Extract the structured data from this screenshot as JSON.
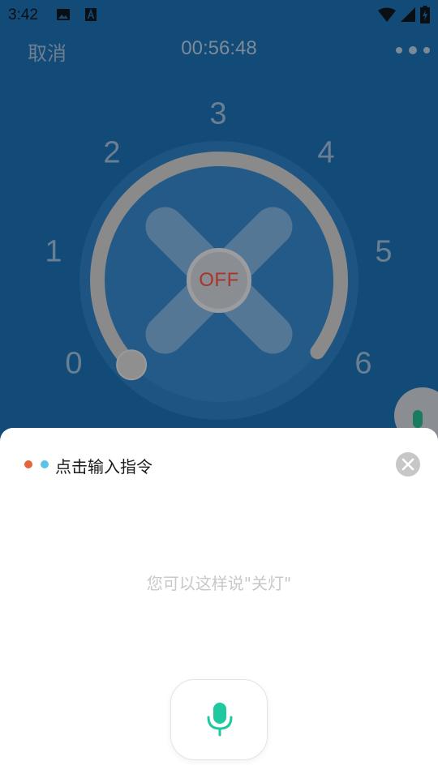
{
  "statusbar": {
    "time": "3:42",
    "icons": [
      "image-icon",
      "a-notification-icon",
      "wifi-icon",
      "cell-signal-icon",
      "battery-charging-icon"
    ]
  },
  "topbar": {
    "cancel_label": "取消",
    "timer": "00:56:48",
    "more_icon": "more-dots-icon"
  },
  "fan": {
    "speed_labels": [
      "0",
      "1",
      "2",
      "3",
      "4",
      "5",
      "6"
    ],
    "current_speed": 0,
    "power_label": "OFF",
    "colors": {
      "power_text": "#a8342c",
      "arc": "#8a8a8a",
      "labels": "#6b7f93",
      "background": "#124a78"
    }
  },
  "voice": {
    "prompt": "点击输入指令",
    "hint": "您可以这样说\"关灯\"",
    "close_icon": "close-icon",
    "mic_icon": "mic-icon",
    "colors": {
      "dot_orange": "#e8643a",
      "dot_blue": "#5bc2e8",
      "mic": "#1ec9a0"
    }
  }
}
